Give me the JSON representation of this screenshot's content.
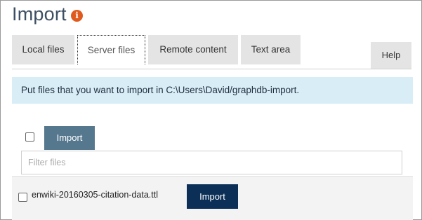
{
  "header": {
    "title": "Import",
    "info_icon_glyph": "i",
    "info_icon": "info-icon"
  },
  "tabs": [
    {
      "label": "Local files",
      "active": false
    },
    {
      "label": "Server files",
      "active": true
    },
    {
      "label": "Remote content",
      "active": false
    },
    {
      "label": "Text area",
      "active": false
    }
  ],
  "help": {
    "label": "Help"
  },
  "alert": {
    "message": "Put files that you want to import in C:\\Users\\David/graphdb-import."
  },
  "toolbar": {
    "import_label": "Import",
    "select_all_checked": false
  },
  "filter": {
    "placeholder": "Filter files",
    "value": ""
  },
  "files": [
    {
      "name": "enwiki-20160305-citation-data.ttl",
      "checked": false,
      "import_label": "Import"
    }
  ],
  "colors": {
    "title": "#3d4f63",
    "info_icon": "#e05a1e",
    "alert_bg": "#d9edf7",
    "import_all_bg": "#56788f",
    "import_row_bg": "#0b2f57",
    "tab_bg": "#e4e4e4"
  }
}
